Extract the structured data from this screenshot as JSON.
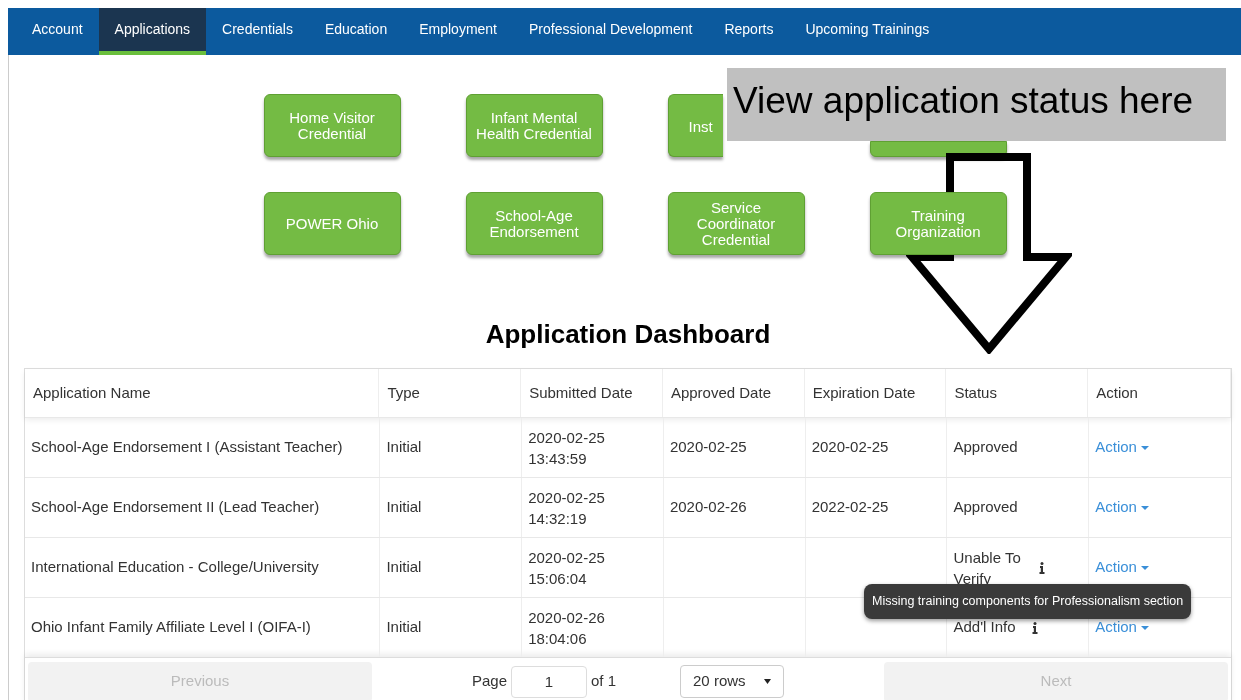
{
  "nav": [
    {
      "label": "Account",
      "selected": false
    },
    {
      "label": "Applications",
      "selected": true
    },
    {
      "label": "Credentials",
      "selected": false
    },
    {
      "label": "Education",
      "selected": false
    },
    {
      "label": "Employment",
      "selected": false
    },
    {
      "label": "Professional Development",
      "selected": false
    },
    {
      "label": "Reports",
      "selected": false
    },
    {
      "label": "Upcoming Trainings",
      "selected": false
    }
  ],
  "application_buttons": [
    {
      "kind": "full",
      "label": "Home Visitor Credential"
    },
    {
      "kind": "full",
      "label": "Infant Mental Health Credential"
    },
    {
      "kind": "partial",
      "label": "Inst"
    },
    {
      "kind": "covered"
    },
    {
      "kind": "full",
      "label": "POWER Ohio"
    },
    {
      "kind": "full",
      "label": "School-Age Endorsement"
    },
    {
      "kind": "full",
      "label": "Service Coordinator Credential"
    },
    {
      "kind": "full",
      "label": "Training Organization"
    }
  ],
  "callout": {
    "text": "View application status here"
  },
  "dashboard": {
    "title": "Application Dashboard",
    "columns": [
      "Application Name",
      "Type",
      "Submitted Date",
      "Approved Date",
      "Expiration Date",
      "Status",
      "Action"
    ],
    "rows": [
      {
        "name": "School-Age Endorsement I (Assistant Teacher)",
        "type": "Initial",
        "submitted": [
          "2020-02-25",
          "13:43:59"
        ],
        "approved": "2020-02-25",
        "expiration": "2020-02-25",
        "status": "Approved",
        "info": false,
        "action": "Action"
      },
      {
        "name": "School-Age Endorsement II (Lead Teacher)",
        "type": "Initial",
        "submitted": [
          "2020-02-25",
          "14:32:19"
        ],
        "approved": "2020-02-26",
        "expiration": "2022-02-25",
        "status": "Approved",
        "info": false,
        "action": "Action"
      },
      {
        "name": "International Education - College/University",
        "type": "Initial",
        "submitted": [
          "2020-02-25",
          "15:06:04"
        ],
        "status": "Unable To Verify",
        "info": true,
        "action": "Action"
      },
      {
        "name": "Ohio Infant Family Affiliate Level I (OIFA-I)",
        "type": "Initial",
        "submitted": [
          "2020-02-26",
          "18:04:06"
        ],
        "status": "Add'l Info",
        "info": true,
        "action": "Action",
        "tooltip": "Missing training components for Professionalism section"
      }
    ],
    "pagination": {
      "previous": "Previous",
      "previous_disabled": true,
      "page_label": "Page",
      "page_value": "1",
      "of": "of 1",
      "rows": "20 rows",
      "next": "Next",
      "next_disabled": true
    }
  }
}
